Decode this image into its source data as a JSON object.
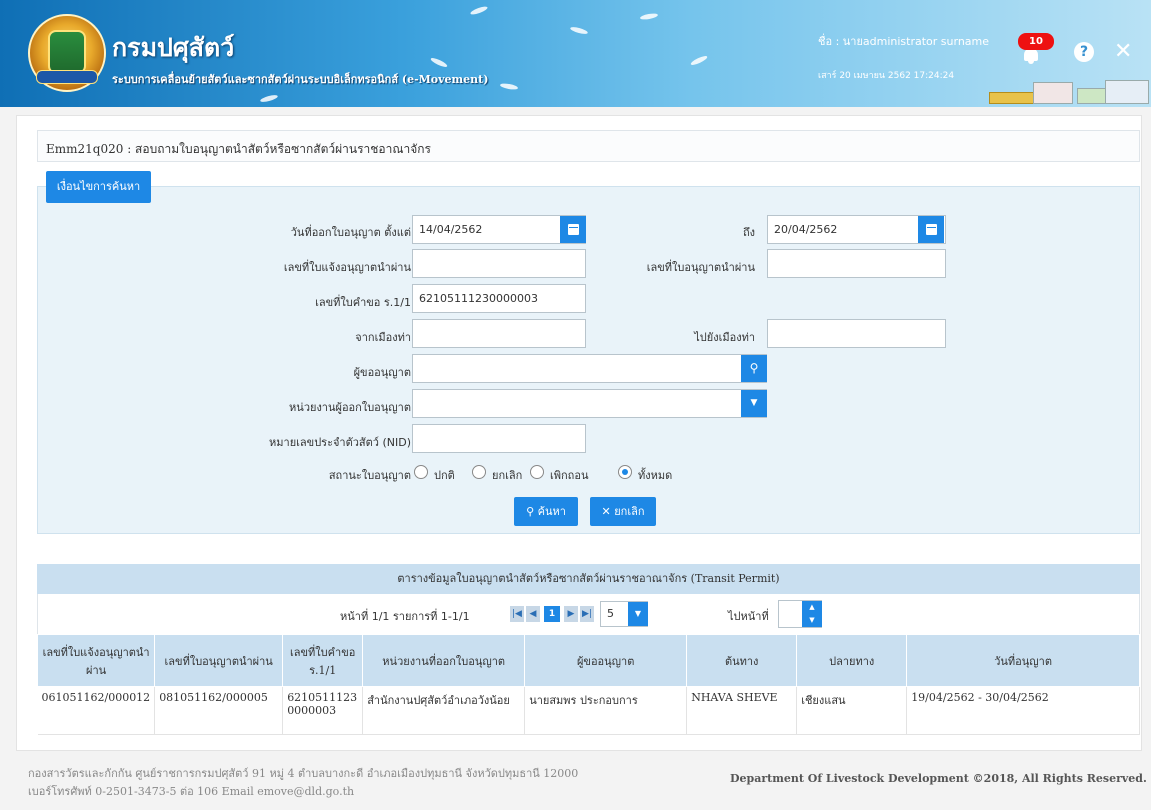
{
  "header": {
    "title": "กรมปศุสัตว์",
    "subtitle": "ระบบการเคลื่อนย้ายสัตว์และซากสัตว์ผ่านระบบอิเล็กทรอนิกส์ (e-Movement)",
    "user": "ชื่อ : นายadministrator surname",
    "datetime": "เสาร์ 20 เมษายน 2562 17:24:24",
    "notification_count": "10"
  },
  "page": {
    "heading": "Emm21q020 : สอบถามใบอนุญาตนำสัตว์หรือซากสัตว์ผ่านราชอาณาจักร",
    "search_tab": "เงื่อนไขการค้นหา"
  },
  "form": {
    "date_from_label": "วันที่ออกใบอนุญาต ตั้งแต่",
    "date_from_value": "14/04/2562",
    "date_to_label": "ถึง",
    "date_to_value": "20/04/2562",
    "notify_no_label": "เลขที่ใบแจ้งอนุญาตนำผ่าน",
    "notify_no_value": "",
    "permit_no_label": "เลขที่ใบอนุญาตนำผ่าน",
    "permit_no_value": "",
    "request_no_label": "เลขที่ใบคำขอ ร.1/1",
    "request_no_value": "62105111230000003",
    "from_port_label": "จากเมืองท่า",
    "from_port_value": "",
    "to_port_label": "ไปยังเมืองท่า",
    "to_port_value": "",
    "applicant_label": "ผู้ขออนุญาต",
    "applicant_value": "",
    "agency_label": "หน่วยงานผู้ออกใบอนุญาต",
    "agency_value": "",
    "nid_label": "หมายเลขประจำตัวสัตว์ (NID)",
    "nid_value": "",
    "status_label": "สถานะใบอนุญาต",
    "status_options": [
      "ปกติ",
      "ยกเลิก",
      "เพิกถอน",
      "ทั้งหมด"
    ],
    "status_selected": "ทั้งหมด",
    "search_button": "ค้นหา",
    "cancel_button": "ยกเลิก"
  },
  "results": {
    "title": "ตารางข้อมูลใบอนุญาตนำสัตว์หรือซากสัตว์ผ่านราชอาณาจักร (Transit Permit)",
    "pager_info": "หน้าที่ 1/1 รายการที่ 1-1/1",
    "current_page": "1",
    "page_size": "5",
    "goto_label": "ไปหน้าที่",
    "goto_value": "",
    "columns": [
      "เลขที่ใบแจ้งอนุญาตนำผ่าน",
      "เลขที่ใบอนุญาตนำผ่าน",
      "เลขที่ใบคำขอ ร.1/1",
      "หน่วยงานที่ออกใบอนุญาต",
      "ผู้ขออนุญาต",
      "ต้นทาง",
      "ปลายทาง",
      "วันที่อนุญาต"
    ],
    "rows": [
      [
        "061051162/000012",
        "081051162/000005",
        "62105111230000003",
        "สำนักงานปศุสัตว์อำเภอวังน้อย",
        "นายสมพร ประกอบการ",
        "NHAVA SHEVE",
        "เชียงแสน",
        "19/04/2562 - 30/04/2562"
      ]
    ]
  },
  "footer": {
    "address_line1": "กองสารวัตรและกักกัน ศูนย์ราชการกรมปศุสัตว์ 91 หมู่ 4 ตำบลบางกะดี อำเภอเมืองปทุมธานี จังหวัดปทุมธานี 12000",
    "address_line2": "เบอร์โทรศัพท์ 0-2501-3473-5 ต่อ 106 Email emove@dld.go.th",
    "copyright": "Department Of Livestock Development ©2018, All Rights Reserved."
  },
  "icons": {
    "calendar": "calendar-icon",
    "search": "search-icon",
    "dropdown": "chevron-down-icon",
    "bell": "bell-icon",
    "help": "help-icon",
    "close": "close-icon"
  },
  "colors": {
    "primary": "#1e88e5",
    "header_start": "#0f6fb5",
    "table_header": "#c9dff0",
    "badge": "#ee1111"
  }
}
